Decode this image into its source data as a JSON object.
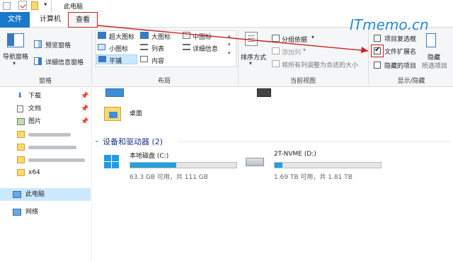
{
  "window": {
    "title": "此电脑"
  },
  "tabs": {
    "file": "文件",
    "computer": "计算机",
    "view": "查看"
  },
  "ribbon": {
    "panes": {
      "nav_pane": "导航窗格",
      "preview_pane": "预览窗格",
      "details_pane": "详细信息窗格",
      "group": "窗格"
    },
    "layout": {
      "items": [
        "超大图标",
        "大图标",
        "中图标",
        "小图标",
        "列表",
        "详细信息",
        "平铺",
        "内容"
      ],
      "group": "布局"
    },
    "current_view": {
      "sort_by": "排序方式",
      "group_by": "分组依据",
      "add_column": "添加列",
      "fit_columns": "将所有列调整为合适的大小",
      "group": "当前视图"
    },
    "show_hide": {
      "item_checkboxes": "项目复选框",
      "file_extensions": "文件扩展名",
      "hidden_items": "隐藏的项目",
      "hide": "隐藏",
      "selected_items": "所选项目",
      "group": "显示/隐藏",
      "item_checkboxes_checked": false,
      "file_extensions_checked": true,
      "hidden_items_checked": false
    }
  },
  "watermark": "ITmemo.cn",
  "nav": {
    "items": [
      {
        "label": "下载",
        "icon": "download-icon",
        "pinned": true
      },
      {
        "label": "文档",
        "icon": "document-icon",
        "pinned": true
      },
      {
        "label": "图片",
        "icon": "picture-icon",
        "pinned": true
      },
      {
        "label": "x64",
        "icon": "folder-icon",
        "pinned": false
      },
      {
        "label": "此电脑",
        "icon": "computer-icon",
        "pinned": false
      },
      {
        "label": "网络",
        "icon": "network-icon",
        "pinned": false
      }
    ]
  },
  "content": {
    "desktop": "桌面",
    "devices_header": "设备和驱动器 (2)",
    "drives": [
      {
        "name": "本地磁盘 (C:)",
        "free": "63.3 GB 可用，共 111 GB",
        "used_fraction": 0.43
      },
      {
        "name": "2T-NVME (D:)",
        "free": "1.69 TB 可用，共 1.81 TB",
        "used_fraction": 0.07
      }
    ]
  },
  "colors": {
    "accent": "#1979ca",
    "highlight": "#cc2222",
    "drive_bar": "#26a0da"
  }
}
